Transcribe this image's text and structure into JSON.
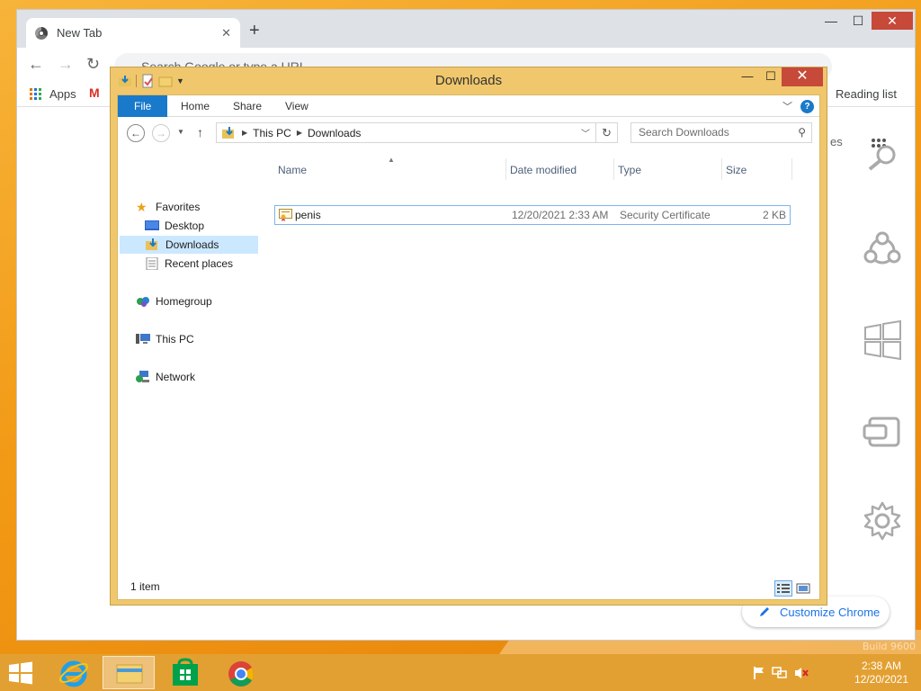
{
  "chrome": {
    "tab_title": "New Tab",
    "tab_close": "✕",
    "new_tab": "+",
    "minimize": "—",
    "maximize": "☐",
    "close": "✕",
    "back": "←",
    "forward": "→",
    "reload": "↻",
    "omnibox_placeholder": "Search Google or type a URL",
    "bookmarks": {
      "apps": "Apps",
      "gmail": "M",
      "reading_list": "Reading list"
    },
    "customize": "Customize Chrome",
    "peek_text": "es"
  },
  "explorer": {
    "title": "Downloads",
    "minimize": "—",
    "maximize": "☐",
    "close": "✕",
    "ribbon_tabs": [
      "File",
      "Home",
      "Share",
      "View"
    ],
    "help": "?",
    "address_path": [
      "This PC",
      "Downloads"
    ],
    "search_placeholder": "Search Downloads",
    "nav": {
      "favorites": "Favorites",
      "desktop": "Desktop",
      "downloads": "Downloads",
      "recent": "Recent places",
      "homegroup": "Homegroup",
      "this_pc": "This PC",
      "network": "Network"
    },
    "columns": {
      "name": "Name",
      "date": "Date modified",
      "type": "Type",
      "size": "Size"
    },
    "files": [
      {
        "name": "penis",
        "date": "12/20/2021 2:33 AM",
        "type": "Security Certificate",
        "size": "2 KB"
      }
    ],
    "status": "1 item"
  },
  "taskbar": {
    "time": "2:38 AM",
    "date": "12/20/2021"
  },
  "desktop": {
    "build": "Build 9600"
  },
  "colors": {
    "accent": "#1979ca",
    "desktop": "#f29a16",
    "taskbar": "#e3a032",
    "frame": "#f0c76c"
  }
}
